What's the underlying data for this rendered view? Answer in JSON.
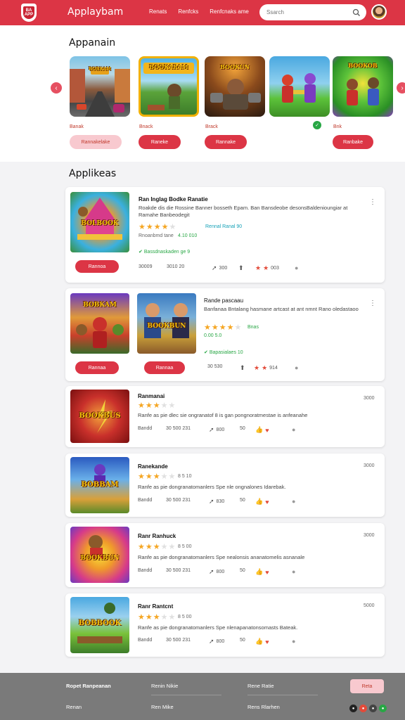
{
  "header": {
    "logo_text": "BA\nAPP",
    "title": "Applaybam",
    "nav": [
      "Renats",
      "Renfcks",
      "Renfcnaks ame"
    ],
    "search_placeholder": "Ssarch",
    "colors": {
      "brand": "#dc3545"
    }
  },
  "featured": {
    "title": "Appanain",
    "items": [
      {
        "art": "BOBKAM",
        "label": "Banak",
        "button": "Rannakelake",
        "button_style": "light"
      },
      {
        "art": "BOOKARAM",
        "label": "Bnack",
        "button": "Raneke"
      },
      {
        "art": "BOOKUN",
        "label": "Brack",
        "button": "Rannake"
      },
      {
        "art": "",
        "label": "",
        "button": ""
      },
      {
        "art": "BOOKOB",
        "label": "Bnk",
        "button": "Ranbake"
      }
    ]
  },
  "applications": {
    "title": "Applikeas",
    "cards": [
      {
        "art": "BOLBOOK",
        "title": "Ran Inglag Bodke Ranatie",
        "desc": "Roakde dis die Rossine Banner bosseth Epam. Ban Bansdeobe desonsBaldenioungiar at Ramahe Banbeodegit",
        "rating": 4.5,
        "rating_meta": "Rennal Ranal 90",
        "rating_meta2": "Rnoanbmd tane",
        "rating_counts": "4.10 010",
        "verified": "Bassdnaskaden ge 9",
        "button": "Rannoa",
        "stats": [
          "30009",
          "3010 20",
          "300",
          "003"
        ]
      },
      {
        "art": "BOBKAM",
        "art2": "BOOKBUN",
        "title": "Rande pascaau",
        "desc": "Banfanaa Bntalang hasmane artcast at ant nmnt Rano oledastaoo",
        "rating": 4.5,
        "rating_meta": "Bnas",
        "rating_counts": "0.00 5.0",
        "verified": "Bapasialaes 10",
        "button": "Rannaa",
        "button2": "Rannaa",
        "stats": [
          "30 530",
          "914"
        ]
      },
      {
        "art": "BOOKBUS",
        "title": "Ranmanai",
        "desc": "Ranfe as pie dlec sie ongranatof 8 is gan pongnoratmestae is anfeanahe",
        "rating": 3,
        "price": "3000",
        "stats": [
          "Bandd",
          "30 500 231",
          "800",
          "50"
        ]
      },
      {
        "art": "BOBBAM",
        "title": "Ranekande",
        "desc": "Ranfe as pie dongranatomanlers Spe nle ongnalones Idarebak.",
        "rating": 3,
        "rating_meta": "8 5 10",
        "price": "3000",
        "stats": [
          "Bandd",
          "30 500 231",
          "830",
          "50"
        ]
      },
      {
        "art": "BOOKBUN",
        "title": "Ranr Ranhuck",
        "desc": "Ranfe as pie dongranatomanlers Spe nealonsis ananatomelis asnanale",
        "rating": 3,
        "rating_meta": "8 5 00",
        "price": "3000",
        "stats": [
          "Bandd",
          "30 500 231",
          "800",
          "50"
        ]
      },
      {
        "art": "BOBBOOK",
        "title": "Ranr Rantcnt",
        "desc": "Ranfe as pie dongranatomanlers Spe nlenapanatonsomasts Bateak.",
        "rating": 3,
        "rating_meta": "8 5 00",
        "price": "5000",
        "stats": [
          "Bandd",
          "30 500 231",
          "800",
          "50"
        ]
      }
    ]
  },
  "footer": {
    "col1": [
      "Ropet Ranpeanan",
      "Renan"
    ],
    "col2": [
      "Renin Nikie",
      "Ren Mike"
    ],
    "col3": [
      "Rene Ratie",
      "Rens Rlarhen"
    ],
    "button": "Reta"
  }
}
